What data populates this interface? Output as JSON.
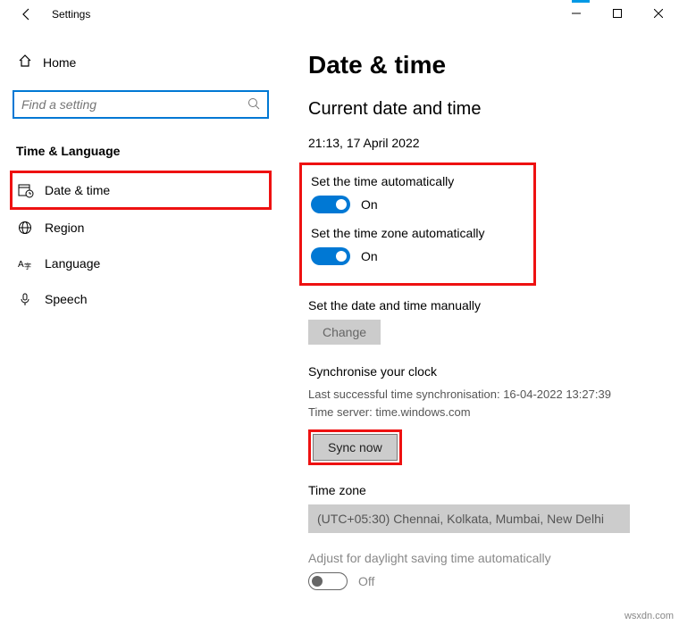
{
  "window": {
    "title": "Settings"
  },
  "sidebar": {
    "home": "Home",
    "search_placeholder": "Find a setting",
    "category": "Time & Language",
    "items": [
      {
        "label": "Date & time"
      },
      {
        "label": "Region"
      },
      {
        "label": "Language"
      },
      {
        "label": "Speech"
      }
    ]
  },
  "main": {
    "title": "Date & time",
    "subtitle": "Current date and time",
    "current_value": "21:13, 17 April 2022",
    "auto_time_label": "Set the time automatically",
    "auto_time_state": "On",
    "auto_tz_label": "Set the time zone automatically",
    "auto_tz_state": "On",
    "manual_label": "Set the date and time manually",
    "change_btn": "Change",
    "sync_header": "Synchronise your clock",
    "sync_last": "Last successful time synchronisation: 16-04-2022 13:27:39",
    "sync_server": "Time server: time.windows.com",
    "sync_btn": "Sync now",
    "tz_header": "Time zone",
    "tz_value": "(UTC+05:30) Chennai, Kolkata, Mumbai, New Delhi",
    "dst_label": "Adjust for daylight saving time automatically",
    "dst_state": "Off"
  },
  "watermark": "wsxdn.com"
}
